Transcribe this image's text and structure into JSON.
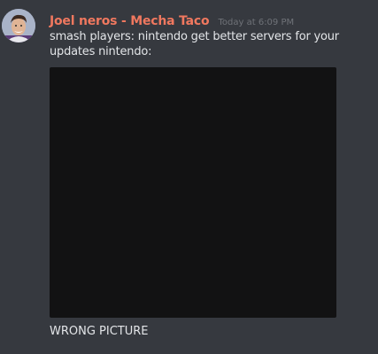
{
  "message": {
    "author": "Joel neros - Mecha Taco",
    "timestamp": "Today at 6:09 PM",
    "text": "smash players: nintendo get better servers for your updates nintendo:",
    "caption": "WRONG PICTURE"
  },
  "colors": {
    "background": "#36393f",
    "username": "#f0785f",
    "text": "#e3e5e8",
    "attachment": "#121213"
  }
}
